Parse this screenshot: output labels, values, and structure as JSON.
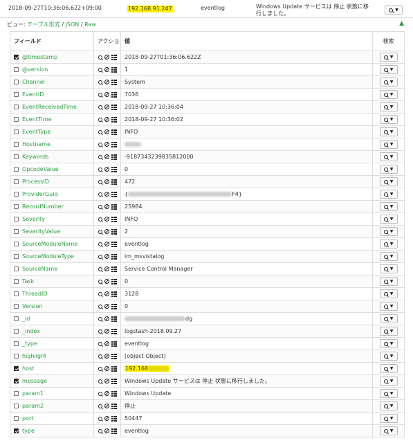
{
  "document": {
    "timestamp": "2018-09-27T10:36:06.622+09:00",
    "ip": "192.168.91.247",
    "type": "eventlog",
    "message": "Windows Update サービスは 停止 状態に移行しました。"
  },
  "view": {
    "prefix": "ビュー:",
    "table_link": "テーブル形式",
    "sep1": " / ",
    "json_link": "JSON",
    "sep2": " / ",
    "raw_link": "Raw"
  },
  "headers": {
    "field": "フィールド",
    "action": "アクショ ン",
    "value": "値",
    "search": "検索"
  },
  "icons": {
    "search": "search-icon",
    "caret": "caret-down-icon",
    "filter_out": "ban-icon",
    "toggle_column": "table-grid-icon",
    "collapse": "chevron-up-icon"
  },
  "colors": {
    "link": "#2a9d3f",
    "highlight": "#fff200"
  },
  "rows": [
    {
      "checked": true,
      "field": "@timestamp",
      "value": "2018-09-27T01:36:06.622Z"
    },
    {
      "checked": false,
      "field": "@version",
      "value": "1"
    },
    {
      "checked": false,
      "field": "Channel",
      "value": "System"
    },
    {
      "checked": false,
      "field": "EventID",
      "value": "7036"
    },
    {
      "checked": false,
      "field": "EventReceivedTime",
      "value": "2018-09-27 10:36:04"
    },
    {
      "checked": false,
      "field": "EventTime",
      "value": "2018-09-27 10:36:02"
    },
    {
      "checked": false,
      "field": "EventType",
      "value": "INFO"
    },
    {
      "checked": false,
      "field": "Hostname",
      "value": "",
      "redacted": true
    },
    {
      "checked": false,
      "field": "Keywords",
      "value": "-9187343239835812000"
    },
    {
      "checked": false,
      "field": "OpcodeValue",
      "value": "0"
    },
    {
      "checked": false,
      "field": "ProcessID",
      "value": "472"
    },
    {
      "checked": false,
      "field": "ProviderGuid",
      "value": "{",
      "redacted": true,
      "suffix": "F4}"
    },
    {
      "checked": false,
      "field": "RecordNumber",
      "value": "25984"
    },
    {
      "checked": false,
      "field": "Severity",
      "value": "INFO"
    },
    {
      "checked": false,
      "field": "SeverityValue",
      "value": "2"
    },
    {
      "checked": false,
      "field": "SourceModuleName",
      "value": "eventlog"
    },
    {
      "checked": false,
      "field": "SourceModuleType",
      "value": "im_msvistalog"
    },
    {
      "checked": false,
      "field": "SourceName",
      "value": "Service Control Manager"
    },
    {
      "checked": false,
      "field": "Task",
      "value": "0"
    },
    {
      "checked": false,
      "field": "ThreadID",
      "value": "3128"
    },
    {
      "checked": false,
      "field": "Version",
      "value": "0"
    },
    {
      "checked": false,
      "field": "_id",
      "value": "",
      "redacted": true,
      "suffix": "dg"
    },
    {
      "checked": false,
      "field": "_index",
      "value": "logstash-2018.09.27"
    },
    {
      "checked": false,
      "field": "_type",
      "value": "eventlog"
    },
    {
      "checked": false,
      "field": "highlight",
      "value": "[object Object]"
    },
    {
      "checked": true,
      "field": "host",
      "value": "192.168",
      "highlighted": true,
      "redacted": true
    },
    {
      "checked": true,
      "field": "message",
      "value": "Windows Update サービスは 停止 状態に移行しました。"
    },
    {
      "checked": false,
      "field": "param1",
      "value": "Windows Update"
    },
    {
      "checked": false,
      "field": "param2",
      "value": "停止"
    },
    {
      "checked": false,
      "field": "port",
      "value": "50447"
    },
    {
      "checked": true,
      "field": "type",
      "value": "eventlog"
    }
  ]
}
